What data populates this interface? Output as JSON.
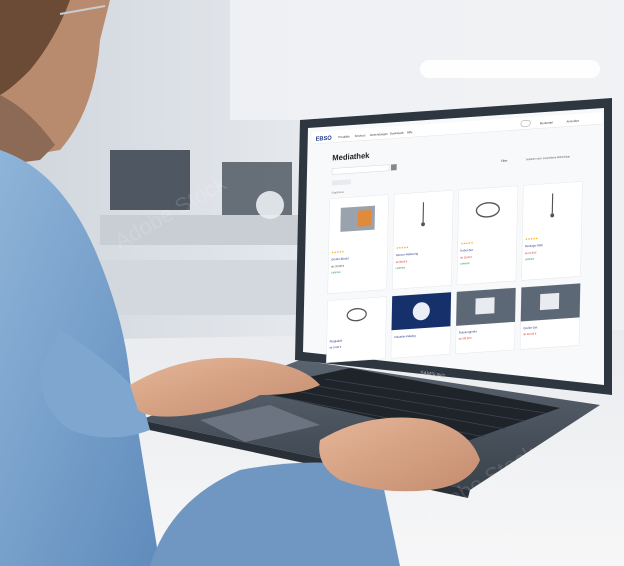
{
  "photo": {
    "watermark": "Adobe Stock",
    "laptop_brand": "SAMSUNG"
  },
  "screen_ui": {
    "header": {
      "brand": "EBSO",
      "nav_items": [
        "Produkte",
        "Services",
        "Anwendungen",
        "Downloads",
        "Hilfe"
      ],
      "right_items": [
        "Merkzettel",
        "Anmelden"
      ]
    },
    "page_title": "Mediathek",
    "filter_label": "Filter",
    "sort_label": "Sortieren nach: Empfohlene Reihenfolge",
    "result_count": "Ergebnisse",
    "product_cards": [
      {
        "name": "Greifer-Modul",
        "price": "ab 125,00 €",
        "status": "Lieferbar",
        "thumb": "gripper"
      },
      {
        "name": "Sensor-Halterung",
        "price": "ab 39,00 €",
        "status": "Lieferbar",
        "thumb": "rod"
      },
      {
        "name": "Kabel-Set",
        "price": "ab 18,50 €",
        "status": "Lieferbar",
        "thumb": "cable"
      },
      {
        "name": "Montage-Stab",
        "price": "ab 22,00 €",
        "status": "Lieferbar",
        "thumb": "rod"
      },
      {
        "name": "Ringkabel",
        "price": "ab 14,90 €",
        "status": "Lieferbar",
        "thumb": "cable"
      },
      {
        "name": "Industrie-Katalog",
        "price": "",
        "status": "",
        "thumb": "poster"
      },
      {
        "name": "Robotergreifer",
        "price": "ab 240,00 €",
        "status": "Lieferbar",
        "thumb": "robot"
      },
      {
        "name": "Greifer-Set",
        "price": "ab 310,00 €",
        "status": "Lieferbar",
        "thumb": "robot"
      }
    ]
  },
  "colors": {
    "screen_bg": "#ffffff",
    "laptop_body": "#2e3640",
    "shirt": "#7ea6cf",
    "skin": "#d9a68a"
  }
}
